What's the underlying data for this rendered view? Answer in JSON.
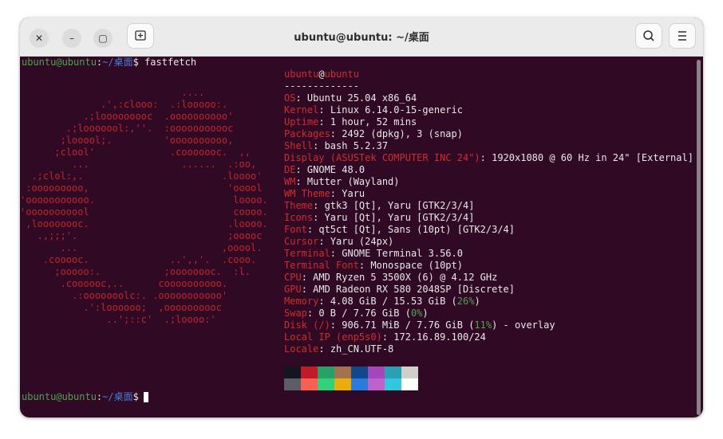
{
  "window": {
    "title": "ubuntu@ubuntu: ~/桌面"
  },
  "toolbar": {
    "close_glyph": "✕",
    "minimize_glyph": "–",
    "maximize_glyph": "▢"
  },
  "prompt1": {
    "userhost": "ubuntu@ubuntu",
    "colon": ":",
    "path": "~/桌面",
    "symbol": "$ ",
    "command": "fastfetch"
  },
  "prompt2": {
    "userhost": "ubuntu@ubuntu",
    "colon": ":",
    "path": "~/桌面",
    "symbol": "$ "
  },
  "logo_lines": [
    "                            ....",
    "              .',:clooo:  .:looooo:.",
    "           .;looooooooc  .oooooooooo'",
    "        .;looooool:,''.  :ooooooooooc",
    "       ;looool;.         'oooooooooo,",
    "      ;clool'             .cooooooc.  ,,",
    "         ...                ......  .:oo,",
    "  .;clol:,.                        .loooo'",
    " :ooooooooo,                        'ooool",
    "'ooooooooooo.                        loooo.",
    "'ooooooooool                         coooo.",
    " ,loooooooc.                        .loooo.",
    "   .,;;;'.                          ;ooooc",
    "       ...                         ,ooool.",
    "    .cooooc.              ..',,'.  .cooo.",
    "      ;ooooo:.           ;oooooooc.  :l.",
    "       .coooooc,..      coooooooooo.",
    "         .:ooooooolc:. .ooooooooooo'",
    "           .':loooooo;  ,oooooooooc",
    "               ..';::c'  .;loooo:'"
  ],
  "info": {
    "user": "ubuntu",
    "at": "@",
    "host": "ubuntu",
    "separator": "-------------",
    "rows": [
      {
        "label": "OS",
        "value": "Ubuntu 25.04 x86_64"
      },
      {
        "label": "Kernel",
        "value": "Linux 6.14.0-15-generic"
      },
      {
        "label": "Uptime",
        "value": "1 hour, 52 mins"
      },
      {
        "label": "Packages",
        "value": "2492 (dpkg), 3 (snap)"
      },
      {
        "label": "Shell",
        "value": "bash 5.2.37"
      },
      {
        "label": "Display (ASUSTek COMPUTER INC 24\")",
        "value": "1920x1080 @ 60 Hz in 24\" [External]"
      },
      {
        "label": "DE",
        "value": "GNOME 48.0"
      },
      {
        "label": "WM",
        "value": "Mutter (Wayland)"
      },
      {
        "label": "WM Theme",
        "value": "Yaru"
      },
      {
        "label": "Theme",
        "value": "gtk3 [Qt], Yaru [GTK2/3/4]"
      },
      {
        "label": "Icons",
        "value": "Yaru [Qt], Yaru [GTK2/3/4]"
      },
      {
        "label": "Font",
        "value": "qt5ct [Qt], Sans (10pt) [GTK2/3/4]"
      },
      {
        "label": "Cursor",
        "value": "Yaru (24px)"
      },
      {
        "label": "Terminal",
        "value": "GNOME Terminal 3.56.0"
      },
      {
        "label": "Terminal Font",
        "value": "Monospace (10pt)"
      },
      {
        "label": "CPU",
        "value": "AMD Ryzen 5 3500X (6) @ 4.12 GHz"
      },
      {
        "label": "GPU",
        "value": "AMD Radeon RX 580 2048SP [Discrete]"
      }
    ],
    "memory": {
      "label": "Memory",
      "pre": "4.08 GiB / 15.53 GiB (",
      "pct": "26%",
      "post": ")"
    },
    "swap": {
      "label": "Swap",
      "pre": "0 B / 7.76 GiB (",
      "pct": "0%",
      "post": ")"
    },
    "disk": {
      "label": "Disk (/)",
      "pre": "906.71 MiB / 7.76 GiB (",
      "pct": "11%",
      "post": ") - overlay"
    },
    "local_ip": {
      "label": "Local IP (enp5s0)",
      "value": "172.16.89.100/24"
    },
    "locale": {
      "label": "Locale",
      "value": "zh_CN.UTF-8"
    }
  },
  "colors": {
    "background": "#300a24",
    "accent_red": "#d12c2c",
    "prompt_green": "#4ea34e",
    "prompt_blue": "#4a7bd8",
    "palette_row1": [
      "#171421",
      "#c01c28",
      "#26a269",
      "#a2734c",
      "#12488b",
      "#a347ba",
      "#2aa1b3",
      "#d0cfcc"
    ],
    "palette_row2": [
      "#5e5c64",
      "#f66151",
      "#33d17a",
      "#e9ad0c",
      "#2a7bde",
      "#c061cb",
      "#33c7de",
      "#ffffff"
    ]
  },
  "icons": [
    "close-icon",
    "minimize-icon",
    "maximize-icon",
    "new-tab-icon",
    "search-icon",
    "menu-icon"
  ]
}
